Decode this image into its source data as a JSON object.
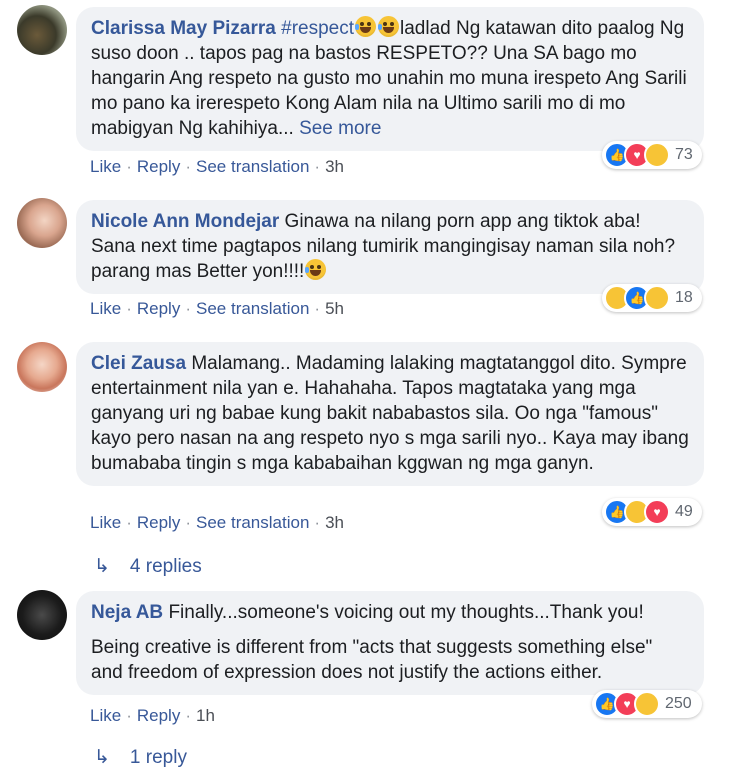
{
  "comments": [
    {
      "author": "Clarissa May Pizarra",
      "hashtag": "#respect",
      "text_line1_after": "ladlad Ng katawan dito paalog",
      "text_rest": "Ng suso doon .. tapos pag na bastos RESPETO?? Una SA bago mo hangarin Ang respeto na gusto mo unahin mo muna irespeto Ang Sarili mo pano ka irerespeto Kong Alam nila na Ultimo sarili mo di mo mabigyan Ng kahihiya... ",
      "see_more": "See more",
      "actions": {
        "like": "Like",
        "reply": "Reply",
        "translate": "See translation",
        "time": "3h"
      },
      "reaction_count": "73",
      "reactions": [
        "like-icon",
        "love-icon",
        "haha-icon"
      ]
    },
    {
      "author": "Nicole Ann Mondejar",
      "text": "Ginawa na nilang porn app ang tiktok aba! Sana next time pagtapos nilang tumirik mangingisay naman sila noh?parang mas Better yon!!!!",
      "actions": {
        "like": "Like",
        "reply": "Reply",
        "translate": "See translation",
        "time": "5h"
      },
      "reaction_count": "18",
      "reactions": [
        "haha-icon",
        "like-icon",
        "wow-icon"
      ]
    },
    {
      "author": "Clei Zausa",
      "text": "Malamang.. Madaming lalaking magtatanggol dito. Sympre entertainment nila yan e. Hahahaha. Tapos magtataka yang mga ganyang uri ng babae kung bakit nababastos sila. Oo nga \"famous\" kayo pero nasan na ang respeto nyo s mga sarili nyo.. Kaya may ibang bumababa tingin s mga kababaihan kggwan ng mga ganyn.",
      "actions": {
        "like": "Like",
        "reply": "Reply",
        "translate": "See translation",
        "time": "3h"
      },
      "reaction_count": "49",
      "reactions": [
        "like-icon",
        "haha-icon",
        "love-icon"
      ],
      "replies": "4 replies"
    },
    {
      "author": "Neja AB",
      "text_para1": "Finally...someone's voicing out my thoughts...Thank you!",
      "text_para2": "Being creative is different from \"acts that suggests something else\" and freedom of expression does not justify the actions either.",
      "actions": {
        "like": "Like",
        "reply": "Reply",
        "time": "1h"
      },
      "reaction_count": "250",
      "reactions": [
        "like-icon",
        "love-icon",
        "care-icon"
      ],
      "replies": "1 reply"
    }
  ]
}
